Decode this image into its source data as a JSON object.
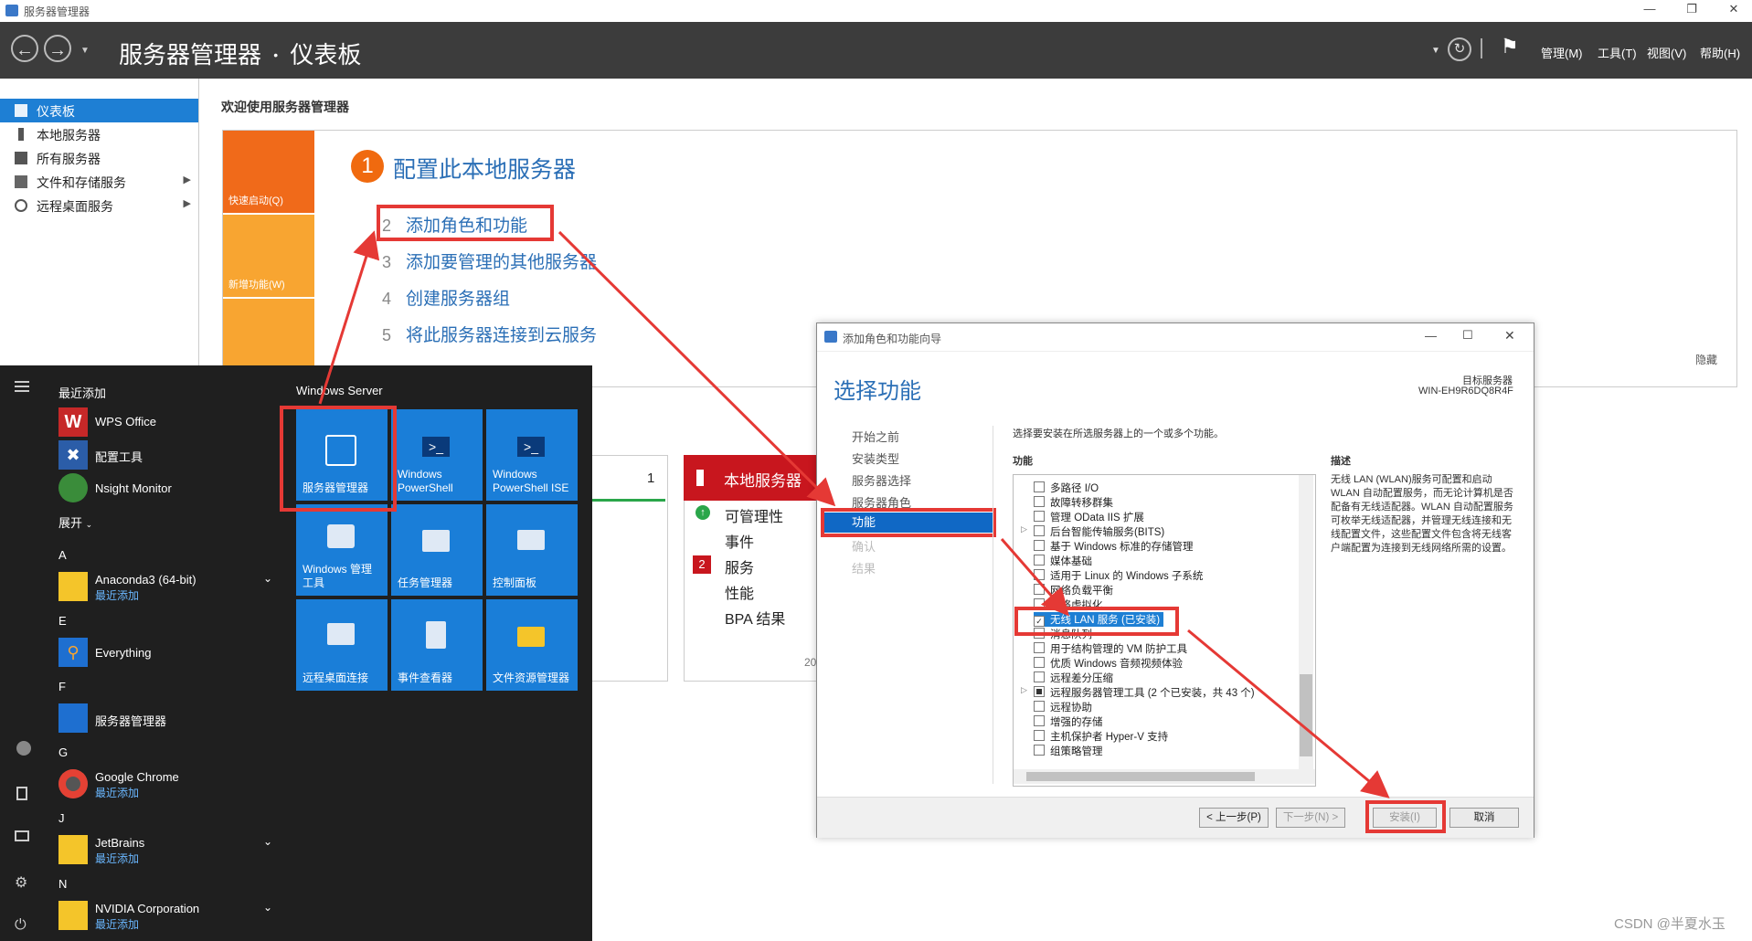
{
  "window": {
    "title": "服务器管理器",
    "controls": [
      "—",
      "❐",
      "✕"
    ]
  },
  "header": {
    "breadcrumb_app": "服务器管理器",
    "breadcrumb_sep": "•",
    "breadcrumb_page": "仪表板",
    "menus": [
      "管理(M)",
      "工具(T)",
      "视图(V)",
      "帮助(H)"
    ]
  },
  "sidebar": {
    "items": [
      {
        "label": "仪表板",
        "icon": "dashboard-icon"
      },
      {
        "label": "本地服务器",
        "icon": "server-icon"
      },
      {
        "label": "所有服务器",
        "icon": "servers-icon"
      },
      {
        "label": "文件和存储服务",
        "icon": "storage-icon"
      },
      {
        "label": "远程桌面服务",
        "icon": "remote-desktop-icon"
      }
    ]
  },
  "main": {
    "welcome_title": "欢迎使用服务器管理器",
    "quick_start": "快速启动(Q)",
    "whats_new": "新增功能(W)",
    "step1_num": "1",
    "step1_label": "配置此本地服务器",
    "steps": [
      {
        "num": "2",
        "label": "添加角色和功能"
      },
      {
        "num": "3",
        "label": "添加要管理的其他服务器"
      },
      {
        "num": "4",
        "label": "创建服务器组"
      },
      {
        "num": "5",
        "label": "将此服务器连接到云服务"
      }
    ],
    "hide": "隐藏",
    "card_count": "1",
    "partial_text": "20"
  },
  "local_server_card": {
    "title": "本地服务器",
    "rows": [
      "可管理性",
      "事件",
      "服务",
      "性能",
      "BPA 结果"
    ],
    "services_badge": "2"
  },
  "start_menu": {
    "recent_header": "最近添加",
    "recent_apps": [
      "WPS Office",
      "配置工具",
      "Nsight Monitor"
    ],
    "expand": "展开",
    "groups": [
      {
        "letter": "A",
        "name": "Anaconda3 (64-bit)",
        "sub": "最近添加"
      },
      {
        "letter": "E",
        "name": "Everything",
        "sub": ""
      },
      {
        "letter": "F",
        "name": "服务器管理器",
        "sub": ""
      },
      {
        "letter": "G",
        "name": "Google Chrome",
        "sub": "最近添加"
      },
      {
        "letter": "J",
        "name": "JetBrains",
        "sub": "最近添加"
      },
      {
        "letter": "N",
        "name": "NVIDIA Corporation",
        "sub": "最近添加"
      }
    ],
    "tiles_header": "Windows Server",
    "tiles": [
      "服务器管理器",
      "Windows PowerShell",
      "Windows PowerShell ISE",
      "Windows 管理工具",
      "任务管理器",
      "控制面板",
      "远程桌面连接",
      "事件查看器",
      "文件资源管理器"
    ]
  },
  "wizard": {
    "title": "添加角色和功能向导",
    "heading": "选择功能",
    "target_label": "目标服务器",
    "target_value": "WIN-EH9R6DQ8R4F",
    "nav": [
      "开始之前",
      "安装类型",
      "服务器选择",
      "服务器角色",
      "功能",
      "确认",
      "结果"
    ],
    "instruction": "选择要安装在所选服务器上的一个或多个功能。",
    "features_label": "功能",
    "description_label": "描述",
    "description": "无线 LAN (WLAN)服务可配置和启动 WLAN 自动配置服务，而无论计算机是否配备有无线适配器。WLAN 自动配置服务可枚举无线适配器，并管理无线连接和无线配置文件，这些配置文件包含将无线客户端配置为连接到无线网络所需的设置。",
    "features": [
      "多路径 I/O",
      "故障转移群集",
      "管理 OData IIS 扩展",
      "后台智能传输服务(BITS)",
      "基于 Windows 标准的存储管理",
      "媒体基础",
      "适用于 Linux 的 Windows 子系统",
      "网络负载平衡",
      "网络虚拟化",
      "无线 LAN 服务 (已安装)",
      "消息队列",
      "用于结构管理的 VM 防护工具",
      "优质 Windows 音频视频体验",
      "远程差分压缩",
      "远程服务器管理工具 (2 个已安装，共 43 个)",
      "远程协助",
      "增强的存储",
      "主机保护者 Hyper-V 支持",
      "组策略管理"
    ],
    "buttons": {
      "prev": "< 上一步(P)",
      "next": "下一步(N) >",
      "install": "安装(I)",
      "cancel": "取消"
    }
  },
  "watermark": "CSDN @半夏水玉"
}
